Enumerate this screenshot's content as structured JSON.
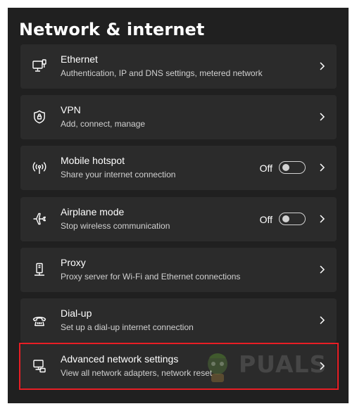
{
  "page": {
    "title": "Network & internet"
  },
  "settings": [
    {
      "key": "ethernet",
      "icon": "ethernet-icon",
      "title": "Ethernet",
      "description": "Authentication, IP and DNS settings, metered network"
    },
    {
      "key": "vpn",
      "icon": "vpn-shield-icon",
      "title": "VPN",
      "description": "Add, connect, manage"
    },
    {
      "key": "mobile-hotspot",
      "icon": "hotspot-icon",
      "title": "Mobile hotspot",
      "description": "Share your internet connection",
      "toggle": {
        "label": "Off",
        "on": false
      }
    },
    {
      "key": "airplane-mode",
      "icon": "airplane-icon",
      "title": "Airplane mode",
      "description": "Stop wireless communication",
      "toggle": {
        "label": "Off",
        "on": false
      }
    },
    {
      "key": "proxy",
      "icon": "proxy-icon",
      "title": "Proxy",
      "description": "Proxy server for Wi-Fi and Ethernet connections"
    },
    {
      "key": "dial-up",
      "icon": "dial-up-icon",
      "title": "Dial-up",
      "description": "Set up a dial-up internet connection"
    },
    {
      "key": "advanced-network-settings",
      "icon": "advanced-network-icon",
      "title": "Advanced network settings",
      "description": "View all network adapters, network reset",
      "highlighted": true
    }
  ],
  "watermark": {
    "text": "PUALS"
  },
  "colors": {
    "window_bg": "#202020",
    "card_bg": "#2b2b2b",
    "highlight": "#e81e25",
    "text_primary": "#ffffff",
    "text_secondary": "#d0d0d0"
  }
}
